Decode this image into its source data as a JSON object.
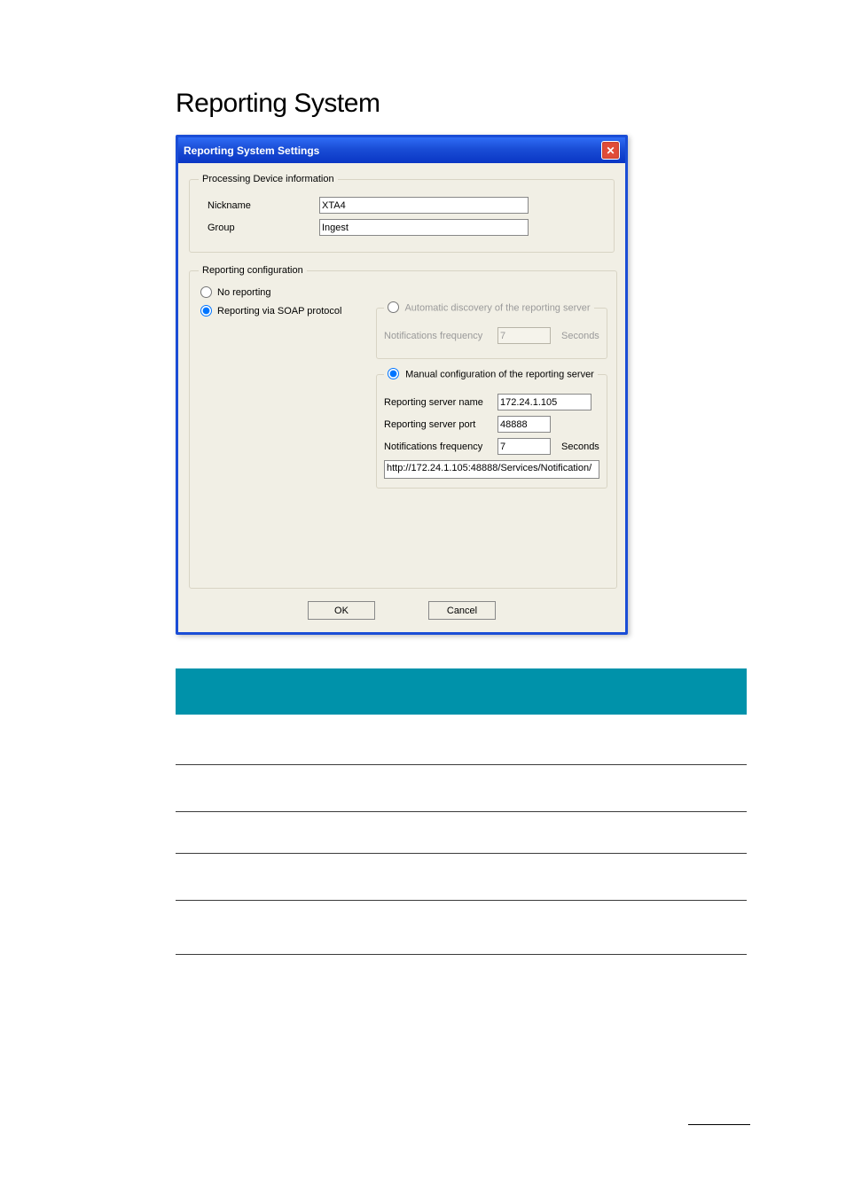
{
  "page_title": "Reporting System",
  "dialog": {
    "title": "Reporting System Settings",
    "close_glyph": "✕",
    "device_info": {
      "legend": "Processing Device information",
      "nickname_label": "Nickname",
      "nickname_value": "XTA4",
      "group_label": "Group",
      "group_value": "Ingest"
    },
    "reporting_config": {
      "legend": "Reporting configuration",
      "no_reporting_label": "No reporting",
      "soap_label": "Reporting via SOAP protocol",
      "auto": {
        "legend": "Automatic discovery of the reporting server",
        "freq_label": "Notifications frequency",
        "freq_value": "7",
        "unit": "Seconds"
      },
      "manual": {
        "legend": "Manual configuration of the reporting server",
        "server_name_label": "Reporting server name",
        "server_name_value": "172.24.1.105",
        "server_port_label": "Reporting server port",
        "server_port_value": "48888",
        "freq_label": "Notifications frequency",
        "freq_value": "7",
        "unit": "Seconds",
        "url": "http://172.24.1.105:48888/Services/Notification/"
      }
    },
    "ok_label": "OK",
    "cancel_label": "Cancel"
  }
}
